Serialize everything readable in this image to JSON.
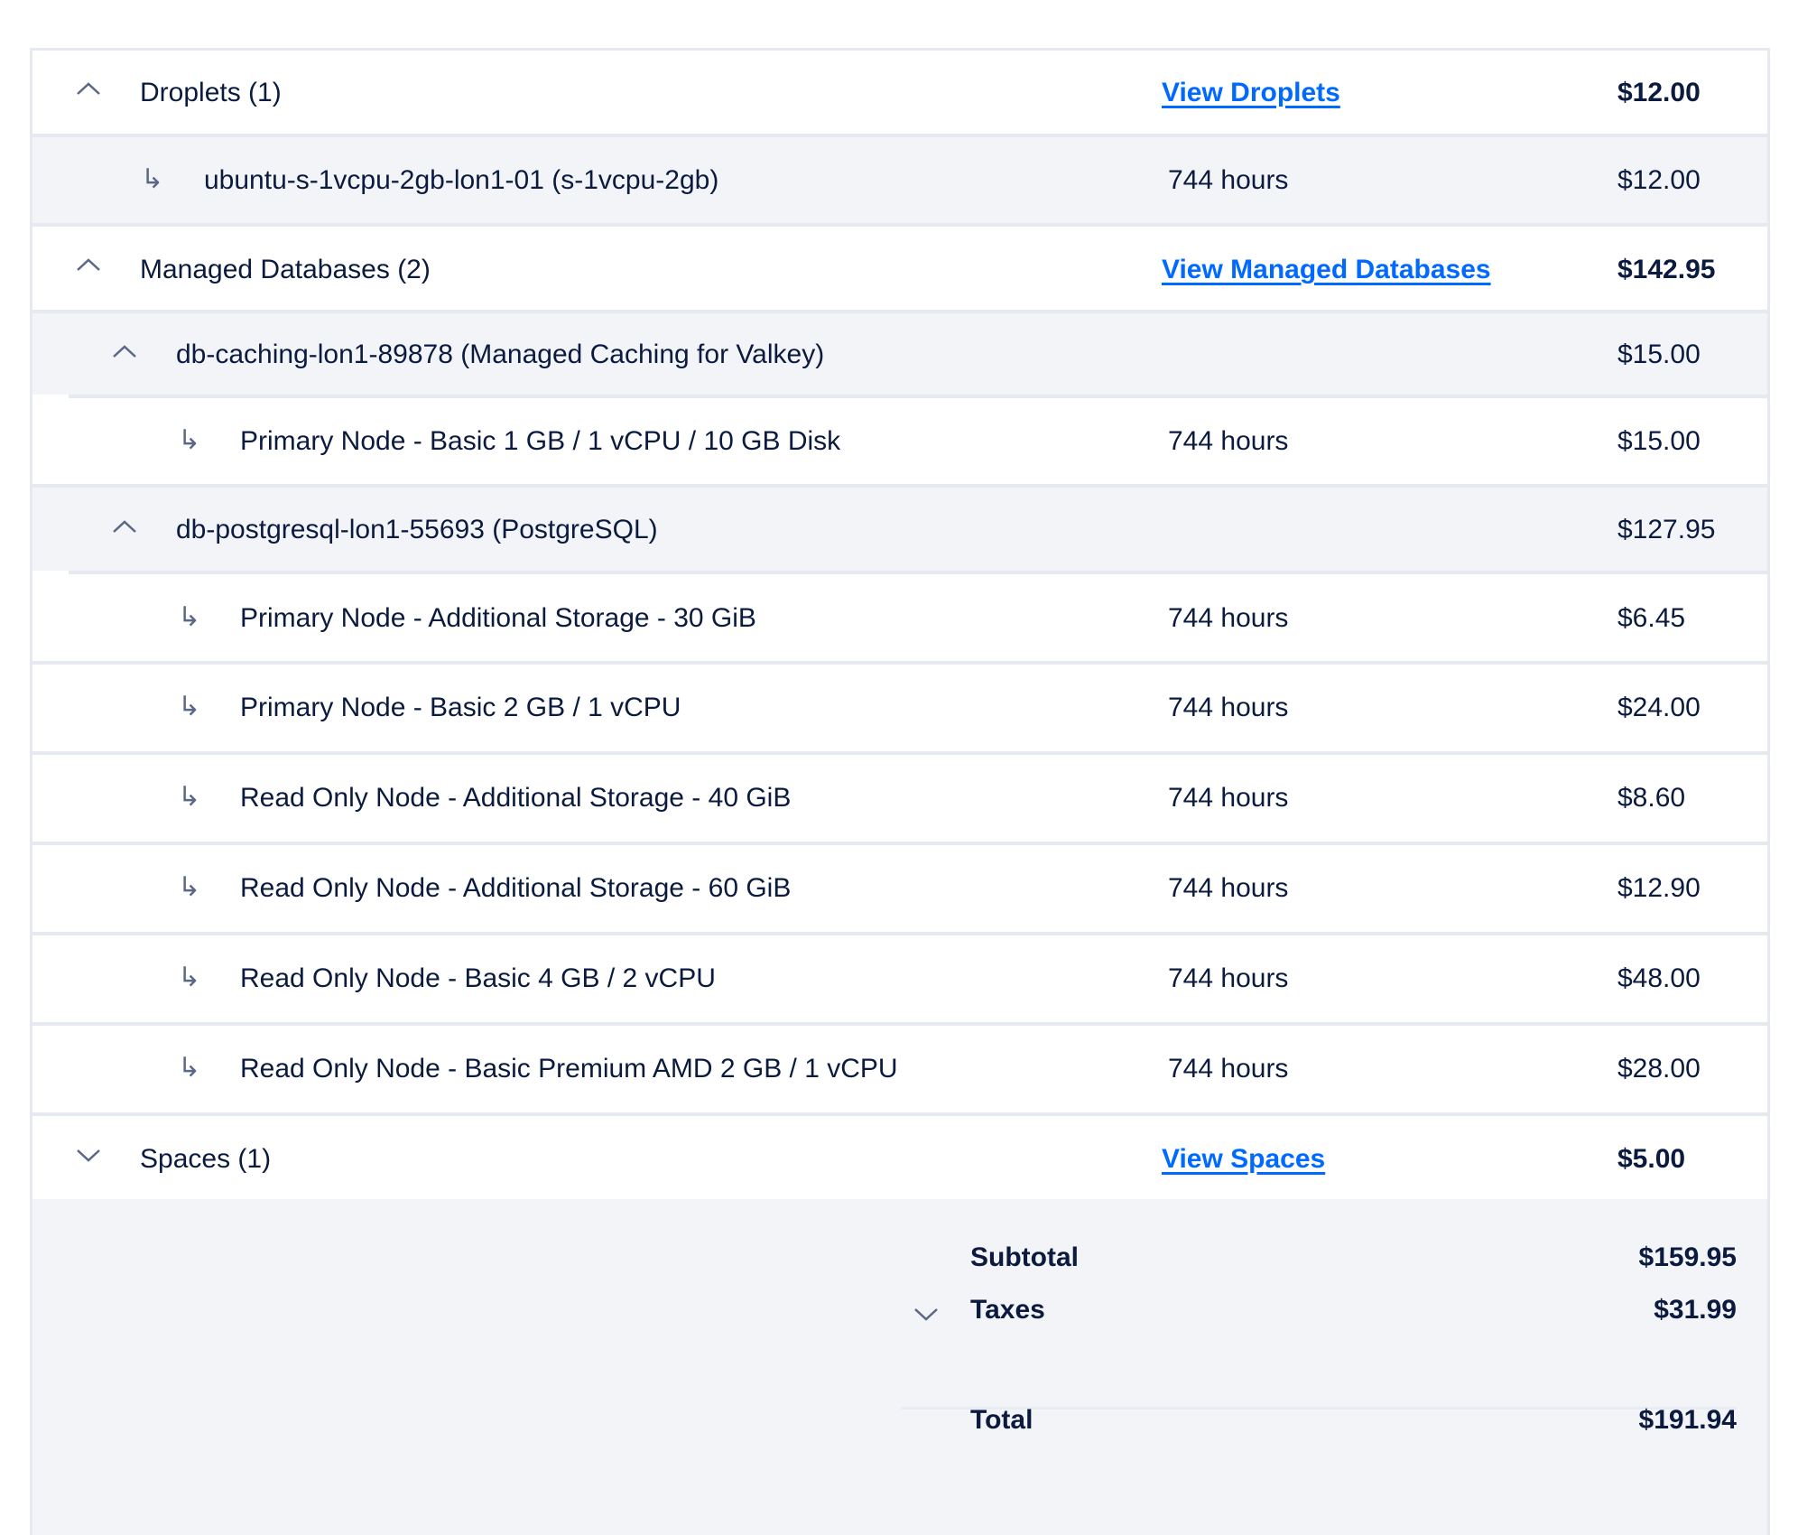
{
  "groups": {
    "droplets": {
      "label": "Droplets (1)",
      "link": "View Droplets",
      "total": "$12.00",
      "items": [
        {
          "name": "ubuntu-s-1vcpu-2gb-lon1-01 (s-1vcpu-2gb)",
          "hours": "744 hours",
          "price": "$12.00"
        }
      ]
    },
    "databases": {
      "label": "Managed Databases (2)",
      "link": "View Managed Databases",
      "total": "$142.95",
      "clusters": [
        {
          "label": "db-caching-lon1-89878 (Managed Caching for Valkey)",
          "total": "$15.00",
          "items": [
            {
              "name": "Primary Node - Basic 1 GB / 1 vCPU / 10 GB Disk",
              "hours": "744 hours",
              "price": "$15.00"
            }
          ]
        },
        {
          "label": "db-postgresql-lon1-55693 (PostgreSQL)",
          "total": "$127.95",
          "items": [
            {
              "name": "Primary Node - Additional Storage - 30 GiB",
              "hours": "744 hours",
              "price": "$6.45"
            },
            {
              "name": "Primary Node - Basic 2 GB / 1 vCPU",
              "hours": "744 hours",
              "price": "$24.00"
            },
            {
              "name": "Read Only Node - Additional Storage - 40 GiB",
              "hours": "744 hours",
              "price": "$8.60"
            },
            {
              "name": "Read Only Node - Additional Storage - 60 GiB",
              "hours": "744 hours",
              "price": "$12.90"
            },
            {
              "name": "Read Only Node - Basic 4 GB / 2 vCPU",
              "hours": "744 hours",
              "price": "$48.00"
            },
            {
              "name": "Read Only Node - Basic Premium AMD 2 GB / 1 vCPU",
              "hours": "744 hours",
              "price": "$28.00"
            }
          ]
        }
      ]
    },
    "spaces": {
      "label": "Spaces (1)",
      "link": "View Spaces",
      "total": "$5.00"
    }
  },
  "summary": {
    "subtotal_label": "Subtotal",
    "subtotal": "$159.95",
    "taxes_label": "Taxes",
    "taxes": "$31.99",
    "total_label": "Total",
    "total": "$191.94"
  },
  "icons": {
    "expanded": "chevron-up-icon",
    "collapsed": "chevron-down-icon",
    "child": "sub-item-arrow-icon"
  },
  "colors": {
    "link": "#0069ff",
    "text": "#0b1b3f",
    "shaded_bg": "#f3f4f8",
    "border": "#e6e9f0"
  }
}
